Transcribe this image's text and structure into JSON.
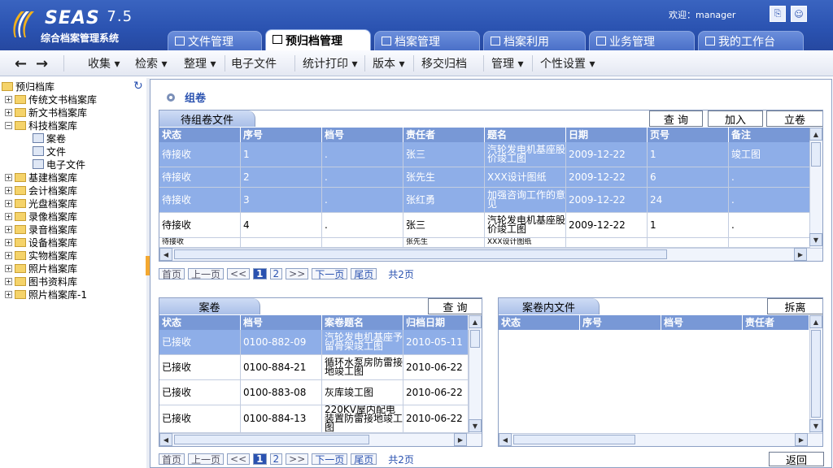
{
  "header": {
    "logo_title": "SEAS",
    "logo_version": "7.5",
    "logo_subtitle": "综合档案管理系统",
    "welcome": "欢迎：manager"
  },
  "tabs": [
    "文件管理",
    "预归档管理",
    "档案管理",
    "档案利用",
    "业务管理",
    "我的工作台"
  ],
  "toolbar": {
    "back": "←",
    "forward": "→",
    "items": [
      "收集 ▾",
      "检索 ▾",
      "整理 ▾",
      "电子文件",
      "统计打印 ▾",
      "版本 ▾",
      "移交归档",
      "管理 ▾",
      "个性设置 ▾"
    ]
  },
  "tree": {
    "root": "预归档库",
    "items": [
      "传统文书档案库",
      "新文书档案库",
      "科技档案库",
      "案卷",
      "文件",
      "电子文件",
      "基建档案库",
      "会计档案库",
      "光盘档案库",
      "录像档案库",
      "录音档案库",
      "设备档案库",
      "实物档案库",
      "照片档案库",
      "图书资料库",
      "照片档案库-1"
    ]
  },
  "main": {
    "title": "组卷"
  },
  "panel1": {
    "tab": "待组卷文件",
    "buttons": [
      "查 询",
      "加入",
      "立卷"
    ],
    "headers": [
      "状态",
      "序号",
      "档号",
      "责任者",
      "题名",
      "日期",
      "页号",
      "备注"
    ],
    "rows": [
      [
        "待接收",
        "1",
        ".",
        "张三",
        "汽轮发电机基座股价竣工图",
        "2009-12-22",
        "1",
        "竣工图"
      ],
      [
        "待接收",
        "2",
        ".",
        "张先生",
        "XXX设计图纸",
        "2009-12-22",
        "6",
        "."
      ],
      [
        "待接收",
        "3",
        ".",
        "张红勇",
        "加强咨询工作的意见",
        "2009-12-22",
        "24",
        "."
      ],
      [
        "待接收",
        "4",
        ".",
        "张三",
        "汽轮发电机基座股价竣工图",
        "2009-12-22",
        "1",
        "."
      ],
      [
        "待接收",
        "",
        "",
        "张先生",
        "XXX设计图纸",
        "",
        "",
        ""
      ]
    ]
  },
  "pager": {
    "first": "首页",
    "prev": "上一页",
    "prev_arrows": "<<",
    "p1": "1",
    "p2": "2",
    "next_arrows": ">>",
    "next": "下一页",
    "last": "尾页",
    "total": "共2页"
  },
  "panel2": {
    "tab": "案卷",
    "button": "查 询",
    "headers": [
      "状态",
      "档号",
      "案卷题名",
      "归档日期"
    ],
    "rows": [
      [
        "已接收",
        "0100-882-09",
        "汽轮发电机基座予留骨架竣工图",
        "2010-05-11"
      ],
      [
        "已接收",
        "0100-884-21",
        "循环水泵房防雷接地竣工图",
        "2010-06-22"
      ],
      [
        "已接收",
        "0100-883-08",
        "灰库竣工图",
        "2010-06-22"
      ],
      [
        "已接收",
        "0100-884-13",
        "220KV屋内配电装置防雷接地竣工图",
        "2010-06-22"
      ]
    ]
  },
  "panel3": {
    "tab": "案卷内文件",
    "button": "拆离",
    "headers": [
      "状态",
      "序号",
      "档号",
      "责任者"
    ]
  },
  "back_button": "返回"
}
